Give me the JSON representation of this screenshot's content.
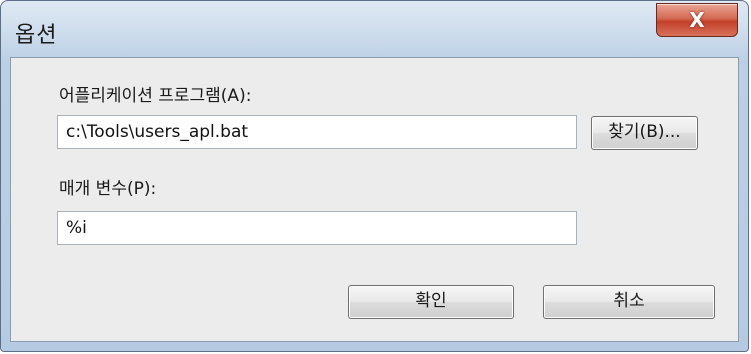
{
  "window": {
    "title": "옵션",
    "close_label": "X"
  },
  "form": {
    "app_label": "어플리케이션 프로그램(A):",
    "app_value": "c:\\Tools\\users_apl.bat",
    "browse_label": "찾기(B)...",
    "param_label": "매개 변수(P):",
    "param_value": "%i"
  },
  "buttons": {
    "ok_label": "확인",
    "cancel_label": "취소"
  },
  "colors": {
    "close_button": "#c7402a",
    "frame": "#bcd0e5",
    "client_background": "#ececec"
  }
}
